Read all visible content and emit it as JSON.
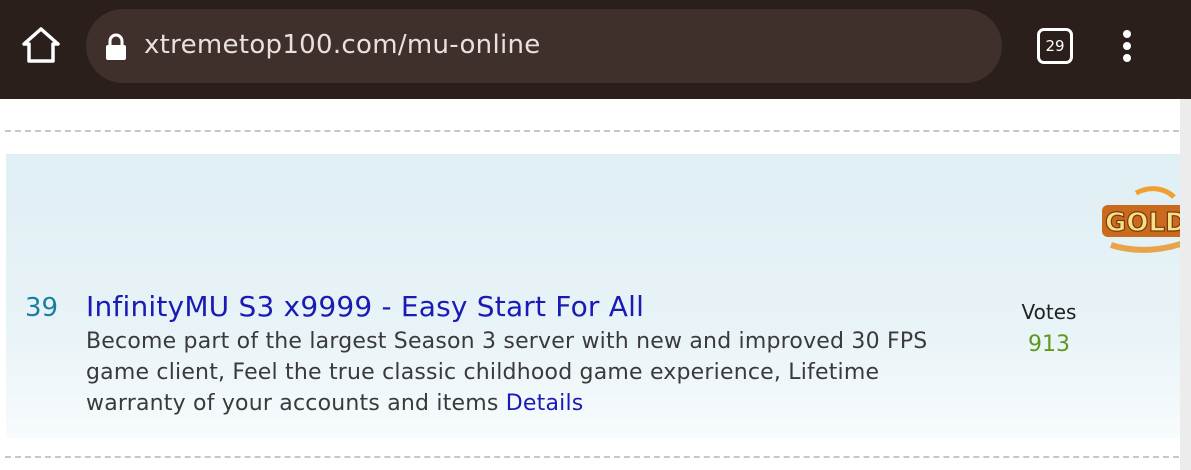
{
  "browser": {
    "url": "xtremetop100.com/mu-online",
    "tab_count": "29",
    "icons": [
      "home-icon",
      "lock-icon",
      "tabs-icon",
      "menu-icon"
    ]
  },
  "listing": {
    "rank": "39",
    "title": "InfinityMU S3 x9999 - Easy Start For All",
    "description": "Become part of the largest Season 3 server with new and improved 30 FPS game client, Feel the true classic childhood game experience, Lifetime warranty of your accounts and items",
    "details_link": "Details",
    "votes_label": "Votes",
    "votes_count": "913",
    "badge_text": "GOLD"
  },
  "colors": {
    "toolbar": "#2b1f1b",
    "urlbar": "#3f302b",
    "title_link": "#1a1ab4",
    "rank": "#1a7ea3",
    "votes": "#5c9a1c",
    "card_bg": "#e3f1f6"
  }
}
